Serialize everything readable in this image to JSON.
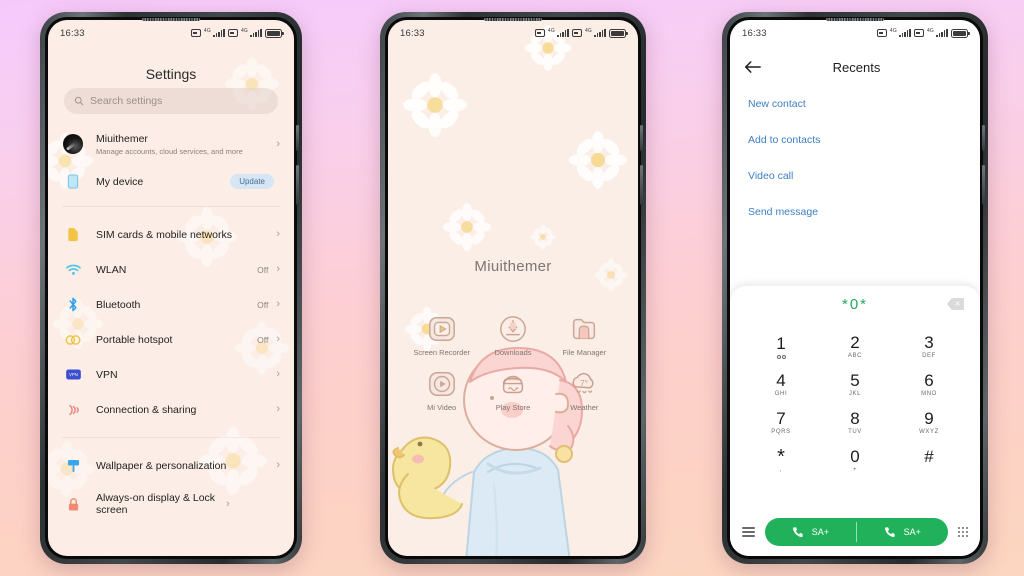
{
  "background": {
    "top_color": "#f6c9fb",
    "bottom_color": "#fcd6c0"
  },
  "phone1": {
    "status": {
      "time": "16:33",
      "network": "4G",
      "sim_count": 2
    },
    "title": "Settings",
    "search": {
      "placeholder": "Search settings",
      "icon": "search-icon"
    },
    "account": {
      "name": "Miuithemer",
      "subtitle": "Manage accounts, cloud services, and more",
      "chevron": "›"
    },
    "device": {
      "label": "My device",
      "badge": "Update",
      "icon": "device-icon"
    },
    "group_network": [
      {
        "label": "SIM cards & mobile networks",
        "value": "",
        "icon": "sim-card-icon",
        "color": "#f5c344"
      },
      {
        "label": "WLAN",
        "value": "Off",
        "icon": "wifi-icon",
        "color": "#45c3e8"
      },
      {
        "label": "Bluetooth",
        "value": "Off",
        "icon": "bluetooth-icon",
        "color": "#2e9ff0"
      },
      {
        "label": "Portable hotspot",
        "value": "Off",
        "icon": "hotspot-icon",
        "color": "#f0c44b"
      },
      {
        "label": "VPN",
        "value": "",
        "icon": "vpn-icon",
        "color": "#3d4fd1"
      },
      {
        "label": "Connection & sharing",
        "value": "",
        "icon": "connection-sharing-icon",
        "color": "#e98686"
      }
    ],
    "group_personal": [
      {
        "label": "Wallpaper & personalization",
        "value": "",
        "icon": "wallpaper-icon",
        "color": "#3da5e8"
      },
      {
        "label": "Always-on display & Lock screen",
        "value": "",
        "icon": "lock-icon",
        "color": "#f08b72"
      }
    ]
  },
  "phone2": {
    "status": {
      "time": "16:33"
    },
    "wallpaper_label": "Miuithemer",
    "apps": [
      {
        "name": "Screen Recorder",
        "icon": "screen-recorder-icon"
      },
      {
        "name": "Downloads",
        "icon": "downloads-icon"
      },
      {
        "name": "File Manager",
        "icon": "file-manager-icon"
      },
      {
        "name": "Mi Video",
        "icon": "mi-video-icon"
      },
      {
        "name": "Play Store",
        "icon": "play-store-icon"
      },
      {
        "name": "Weather",
        "icon": "weather-icon"
      }
    ],
    "weather_temp": "7°"
  },
  "phone3": {
    "status": {
      "time": "16:33"
    },
    "header": {
      "back_icon": "back-arrow-icon",
      "title": "Recents"
    },
    "links": [
      {
        "label": "New contact"
      },
      {
        "label": "Add to contacts"
      },
      {
        "label": "Video call"
      },
      {
        "label": "Send message"
      }
    ],
    "dialed_number": "*0*",
    "number_color": "#22a963",
    "backspace_icon": "backspace-icon",
    "keys": [
      {
        "digit": "1",
        "sub": ""
      },
      {
        "digit": "2",
        "sub": "ABC"
      },
      {
        "digit": "3",
        "sub": "DEF"
      },
      {
        "digit": "4",
        "sub": "GHI"
      },
      {
        "digit": "5",
        "sub": "JKL"
      },
      {
        "digit": "6",
        "sub": "MNO"
      },
      {
        "digit": "7",
        "sub": "PQRS"
      },
      {
        "digit": "8",
        "sub": "TUV"
      },
      {
        "digit": "9",
        "sub": "WXYZ"
      },
      {
        "digit": "*",
        "sub": ","
      },
      {
        "digit": "0",
        "sub": "+"
      },
      {
        "digit": "#",
        "sub": ""
      }
    ],
    "call_buttons": [
      {
        "label": "SA+",
        "icon": "phone-call-icon"
      },
      {
        "label": "SA+",
        "icon": "phone-call-icon"
      }
    ],
    "menu_icon": "hamburger-menu-icon",
    "keypad_icon": "keypad-grid-icon",
    "accent_color": "#21b15b"
  }
}
